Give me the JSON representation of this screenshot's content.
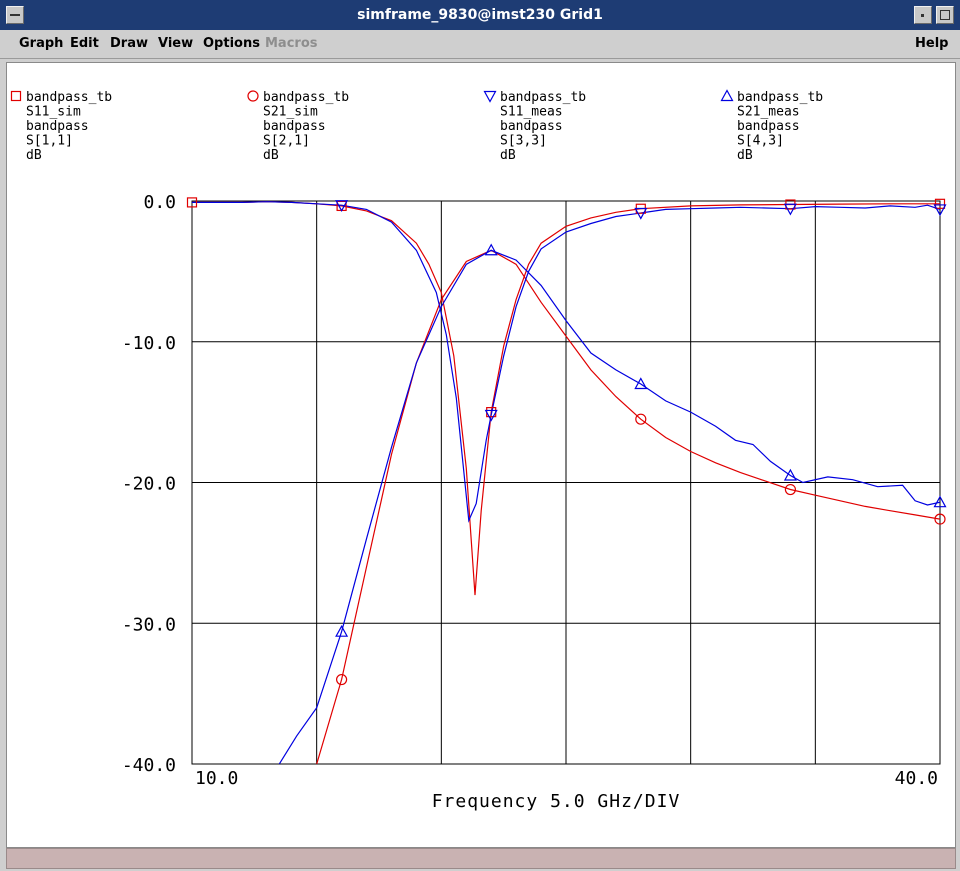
{
  "window": {
    "title": "simframe_9830@imst230 Grid1"
  },
  "menu": {
    "graph": "Graph",
    "edit": "Edit",
    "draw": "Draw",
    "view": "View",
    "options": "Options",
    "macros": "Macros",
    "help": "Help"
  },
  "colors": {
    "sim": "#e00000",
    "meas": "#0000e0",
    "grid": "#000000",
    "titlebar": "#1e3c74",
    "statusbar": "#c9b2b2"
  },
  "chart_data": {
    "type": "line",
    "xlabel": "Frequency 5.0 GHz/DIV",
    "ylabel": "",
    "xlim": [
      10,
      40
    ],
    "ylim": [
      -40,
      0
    ],
    "x_ticks": [
      10,
      15,
      20,
      25,
      30,
      35,
      40
    ],
    "y_ticks": [
      0,
      -10,
      -20,
      -30,
      -40
    ],
    "x_tick_labels": [
      "10.0",
      "40.0"
    ],
    "y_tick_labels": [
      "0.0",
      "-10.0",
      "-20.0",
      "-30.0",
      "-40.0"
    ],
    "grid": true,
    "legend_position": "top",
    "legend": [
      {
        "marker": "square",
        "color": "#e00000",
        "lines": [
          "bandpass_tb",
          "S11_sim",
          "bandpass",
          "S[1,1]",
          "dB"
        ]
      },
      {
        "marker": "circle",
        "color": "#e00000",
        "lines": [
          "bandpass_tb",
          "S21_sim",
          "bandpass",
          "S[2,1]",
          "dB"
        ]
      },
      {
        "marker": "triangle-down",
        "color": "#0000e0",
        "lines": [
          "bandpass_tb",
          "S11_meas",
          "bandpass",
          "S[3,3]",
          "dB"
        ]
      },
      {
        "marker": "triangle-up",
        "color": "#0000e0",
        "lines": [
          "bandpass_tb",
          "S21_meas",
          "bandpass",
          "S[4,3]",
          "dB"
        ]
      }
    ],
    "series": [
      {
        "name": "S11_sim",
        "color": "#e00000",
        "marker": "square",
        "marker_x": [
          10,
          16,
          22,
          28,
          34,
          40
        ],
        "points": [
          [
            10,
            -0.1
          ],
          [
            12,
            -0.1
          ],
          [
            13,
            -0.05
          ],
          [
            14,
            -0.1
          ],
          [
            15,
            -0.2
          ],
          [
            16,
            -0.35
          ],
          [
            17,
            -0.7
          ],
          [
            18,
            -1.4
          ],
          [
            19,
            -3.0
          ],
          [
            19.5,
            -4.5
          ],
          [
            20,
            -6.5
          ],
          [
            20.5,
            -11
          ],
          [
            21,
            -19
          ],
          [
            21.35,
            -28
          ],
          [
            21.6,
            -22
          ],
          [
            22,
            -15
          ],
          [
            22.5,
            -10.3
          ],
          [
            23,
            -7.0
          ],
          [
            23.5,
            -4.5
          ],
          [
            24,
            -3.0
          ],
          [
            25,
            -1.8
          ],
          [
            26,
            -1.2
          ],
          [
            27,
            -0.8
          ],
          [
            28,
            -0.55
          ],
          [
            30,
            -0.35
          ],
          [
            32,
            -0.28
          ],
          [
            34,
            -0.25
          ],
          [
            36,
            -0.22
          ],
          [
            38,
            -0.2
          ],
          [
            40,
            -0.2
          ]
        ]
      },
      {
        "name": "S21_sim",
        "color": "#e00000",
        "marker": "circle",
        "marker_x": [
          16,
          28,
          34,
          40
        ],
        "points": [
          [
            15,
            -40
          ],
          [
            16,
            -34
          ],
          [
            17,
            -26
          ],
          [
            18,
            -18
          ],
          [
            19,
            -11.5
          ],
          [
            20,
            -7.0
          ],
          [
            21,
            -4.3
          ],
          [
            22,
            -3.5
          ],
          [
            23,
            -4.5
          ],
          [
            24,
            -7.2
          ],
          [
            25,
            -9.6
          ],
          [
            26,
            -12.0
          ],
          [
            27,
            -13.9
          ],
          [
            28,
            -15.5
          ],
          [
            29,
            -16.8
          ],
          [
            30,
            -17.8
          ],
          [
            31,
            -18.6
          ],
          [
            32,
            -19.3
          ],
          [
            33,
            -19.9
          ],
          [
            34,
            -20.5
          ],
          [
            35,
            -20.9
          ],
          [
            36,
            -21.3
          ],
          [
            37,
            -21.7
          ],
          [
            38,
            -22.0
          ],
          [
            39,
            -22.3
          ],
          [
            40,
            -22.6
          ]
        ]
      },
      {
        "name": "S11_meas",
        "color": "#0000e0",
        "marker": "triangle-down",
        "marker_x": [
          16,
          22,
          28,
          34,
          40
        ],
        "points": [
          [
            10,
            -0.1
          ],
          [
            12,
            -0.1
          ],
          [
            13,
            -0.05
          ],
          [
            14,
            -0.1
          ],
          [
            15,
            -0.2
          ],
          [
            16,
            -0.3
          ],
          [
            17,
            -0.6
          ],
          [
            18,
            -1.5
          ],
          [
            19,
            -3.5
          ],
          [
            19.8,
            -6.5
          ],
          [
            20.2,
            -9.5
          ],
          [
            20.6,
            -14
          ],
          [
            21.1,
            -22.7
          ],
          [
            21.4,
            -21.5
          ],
          [
            21.8,
            -17
          ],
          [
            22,
            -15.2
          ],
          [
            22.5,
            -11
          ],
          [
            23,
            -7.5
          ],
          [
            23.5,
            -5.0
          ],
          [
            24,
            -3.4
          ],
          [
            25,
            -2.2
          ],
          [
            26,
            -1.6
          ],
          [
            27,
            -1.1
          ],
          [
            28,
            -0.85
          ],
          [
            29,
            -0.6
          ],
          [
            30,
            -0.55
          ],
          [
            31,
            -0.5
          ],
          [
            32,
            -0.45
          ],
          [
            33,
            -0.5
          ],
          [
            34,
            -0.55
          ],
          [
            35,
            -0.4
          ],
          [
            36,
            -0.45
          ],
          [
            37,
            -0.5
          ],
          [
            38,
            -0.35
          ],
          [
            39,
            -0.45
          ],
          [
            39.5,
            -0.3
          ],
          [
            40,
            -0.6
          ]
        ]
      },
      {
        "name": "S21_meas",
        "color": "#0000e0",
        "marker": "triangle-up",
        "marker_x": [
          16,
          22,
          28,
          34,
          40
        ],
        "points": [
          [
            13.5,
            -40
          ],
          [
            14.2,
            -38
          ],
          [
            15,
            -36
          ],
          [
            16,
            -30.6
          ],
          [
            17,
            -24
          ],
          [
            18,
            -17.5
          ],
          [
            19,
            -11.5
          ],
          [
            20,
            -7.5
          ],
          [
            21,
            -4.5
          ],
          [
            22,
            -3.5
          ],
          [
            23,
            -4.2
          ],
          [
            24,
            -6.0
          ],
          [
            25,
            -8.5
          ],
          [
            26,
            -10.8
          ],
          [
            27,
            -12.0
          ],
          [
            28,
            -13.0
          ],
          [
            29,
            -14.2
          ],
          [
            30,
            -15.0
          ],
          [
            31,
            -16.0
          ],
          [
            31.8,
            -17.0
          ],
          [
            32.5,
            -17.3
          ],
          [
            33.2,
            -18.5
          ],
          [
            34,
            -19.5
          ],
          [
            34.5,
            -20.0
          ],
          [
            35.5,
            -19.6
          ],
          [
            36.5,
            -19.8
          ],
          [
            37.5,
            -20.3
          ],
          [
            38.5,
            -20.2
          ],
          [
            39,
            -21.3
          ],
          [
            39.5,
            -21.6
          ],
          [
            40,
            -21.4
          ]
        ]
      }
    ]
  }
}
